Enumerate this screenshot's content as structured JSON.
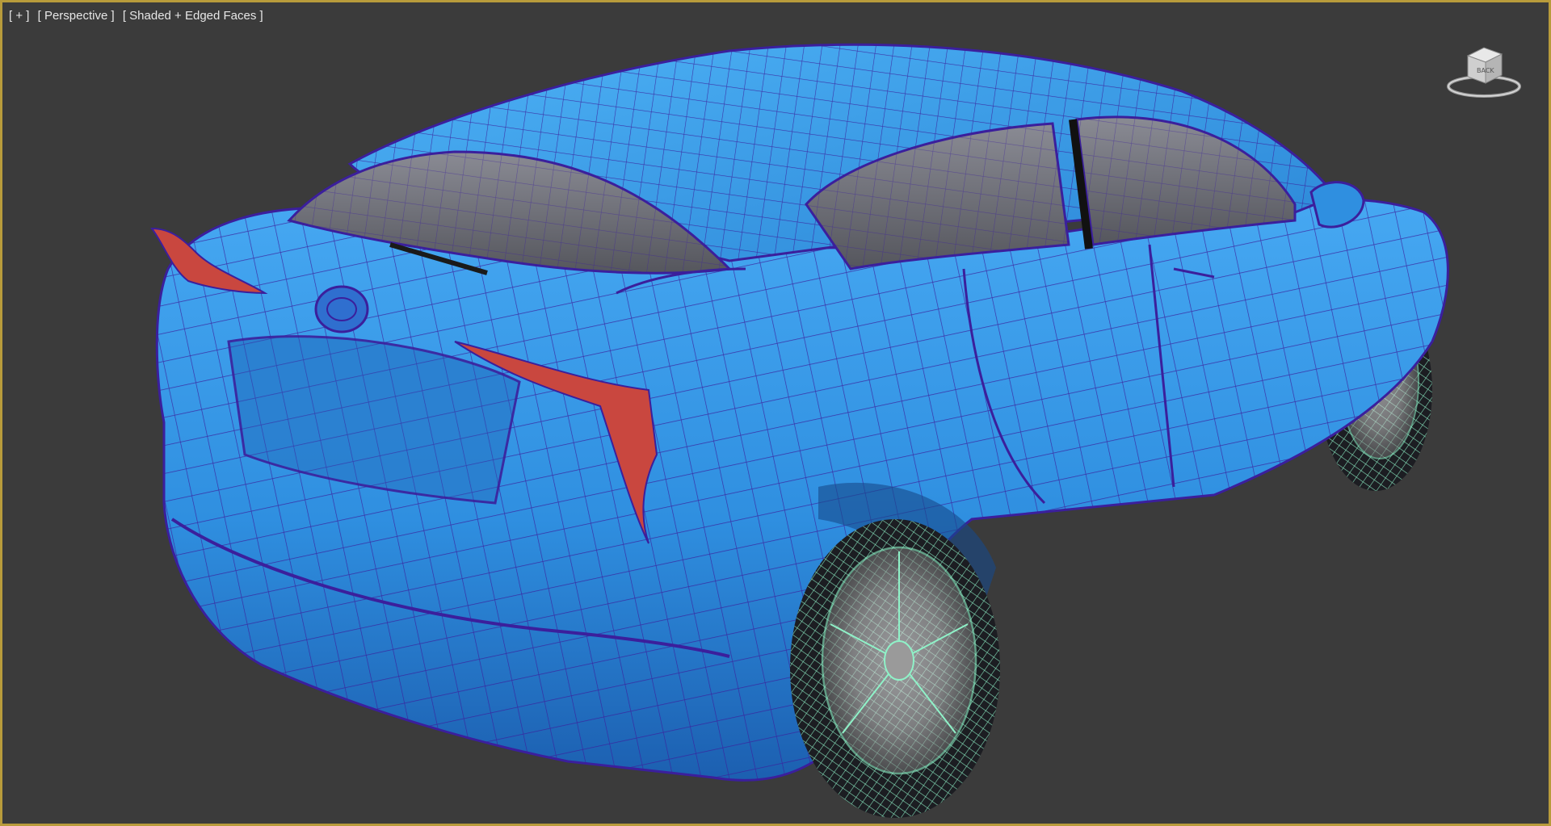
{
  "viewport": {
    "menu_label": "[ + ]",
    "view_label": "[ Perspective ]",
    "shading_label": "[ Shaded + Edged Faces ]"
  },
  "viewcube": {
    "icon": "viewcube-icon",
    "face_label": "BACK"
  },
  "scene": {
    "object": "car-mesh",
    "colors": {
      "background": "#3b3b3b",
      "border_active": "#b89b3b",
      "body": "#2f8fe0",
      "body_shade": "#1f63b5",
      "edge_wire": "#3b1f9c",
      "taillight": "#c9473f",
      "glass": "#6e6f78",
      "wheel_wire": "#8ff2c8",
      "rim": "#d8d8d8"
    }
  }
}
